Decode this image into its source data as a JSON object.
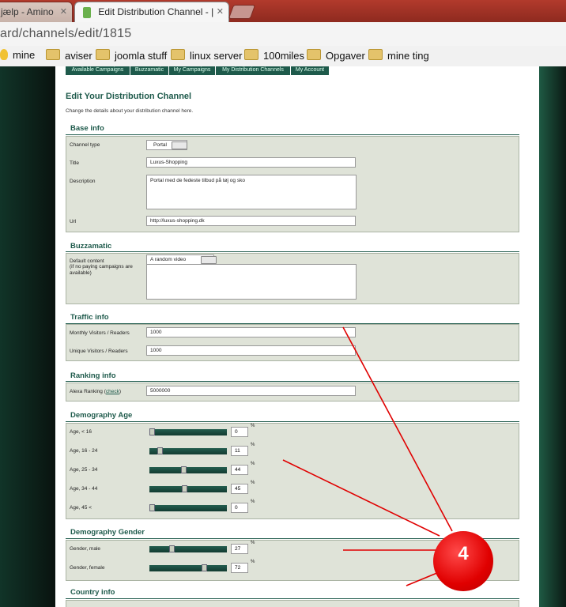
{
  "browser": {
    "tabs": [
      {
        "label": "jælp - Amino"
      },
      {
        "label": "Edit Distribution Channel - |"
      }
    ],
    "url": "ard/channels/edit/1815",
    "bookmarks": [
      "mine",
      "aviser",
      "joomla stuff",
      "linux server",
      "100miles",
      "Opgaver",
      "mine ting"
    ]
  },
  "nav": {
    "tabs": [
      "Available Campaigns",
      "Buzzamatic",
      "My Campaigns",
      "My Distribution Channels",
      "My Account"
    ]
  },
  "page": {
    "title": "Edit Your Distribution Channel",
    "subtitle": "Change the details about your distribution channel here."
  },
  "base_info": {
    "heading": "Base info",
    "channel_type_label": "Channel type",
    "channel_type_value": "Portal",
    "title_label": "Title",
    "title_value": "Luxus-Shopping",
    "description_label": "Description",
    "description_value": "Portal med de fedeste tilbud på tøj og sko",
    "url_label": "Url",
    "url_value": "http://luxus-shopping.dk"
  },
  "buzzamatic": {
    "heading": "Buzzamatic",
    "default_content_label": "Default content",
    "default_content_note": "(if no paying campaigns are available)",
    "default_content_value": "A random video"
  },
  "traffic": {
    "heading": "Traffic info",
    "monthly_label": "Monthly Visitors / Readers",
    "monthly_value": "1000",
    "unique_label": "Unique Visitors / Readers",
    "unique_value": "1000"
  },
  "ranking": {
    "heading": "Ranking info",
    "alexa_label": "Alexa Ranking (",
    "alexa_link": "check",
    "alexa_label_end": ")",
    "alexa_value": "5000000"
  },
  "age": {
    "heading": "Demography Age",
    "unit": "%",
    "rows": [
      {
        "label": "Age, < 16",
        "value": "0",
        "level": 0
      },
      {
        "label": "Age, 16 - 24",
        "value": "11",
        "level": 11
      },
      {
        "label": "Age, 25 - 34",
        "value": "44",
        "level": 44
      },
      {
        "label": "Age, 34 - 44",
        "value": "45",
        "level": 45
      },
      {
        "label": "Age, 45 <",
        "value": "0",
        "level": 0
      }
    ]
  },
  "gender": {
    "heading": "Demography Gender",
    "unit": "%",
    "rows": [
      {
        "label": "Gender, male",
        "value": "27",
        "level": 27
      },
      {
        "label": "Gender, female",
        "value": "72",
        "level": 72
      }
    ]
  },
  "country": {
    "heading": "Country info"
  },
  "annotation": {
    "badge_number": "4",
    "color": "#e00000"
  }
}
